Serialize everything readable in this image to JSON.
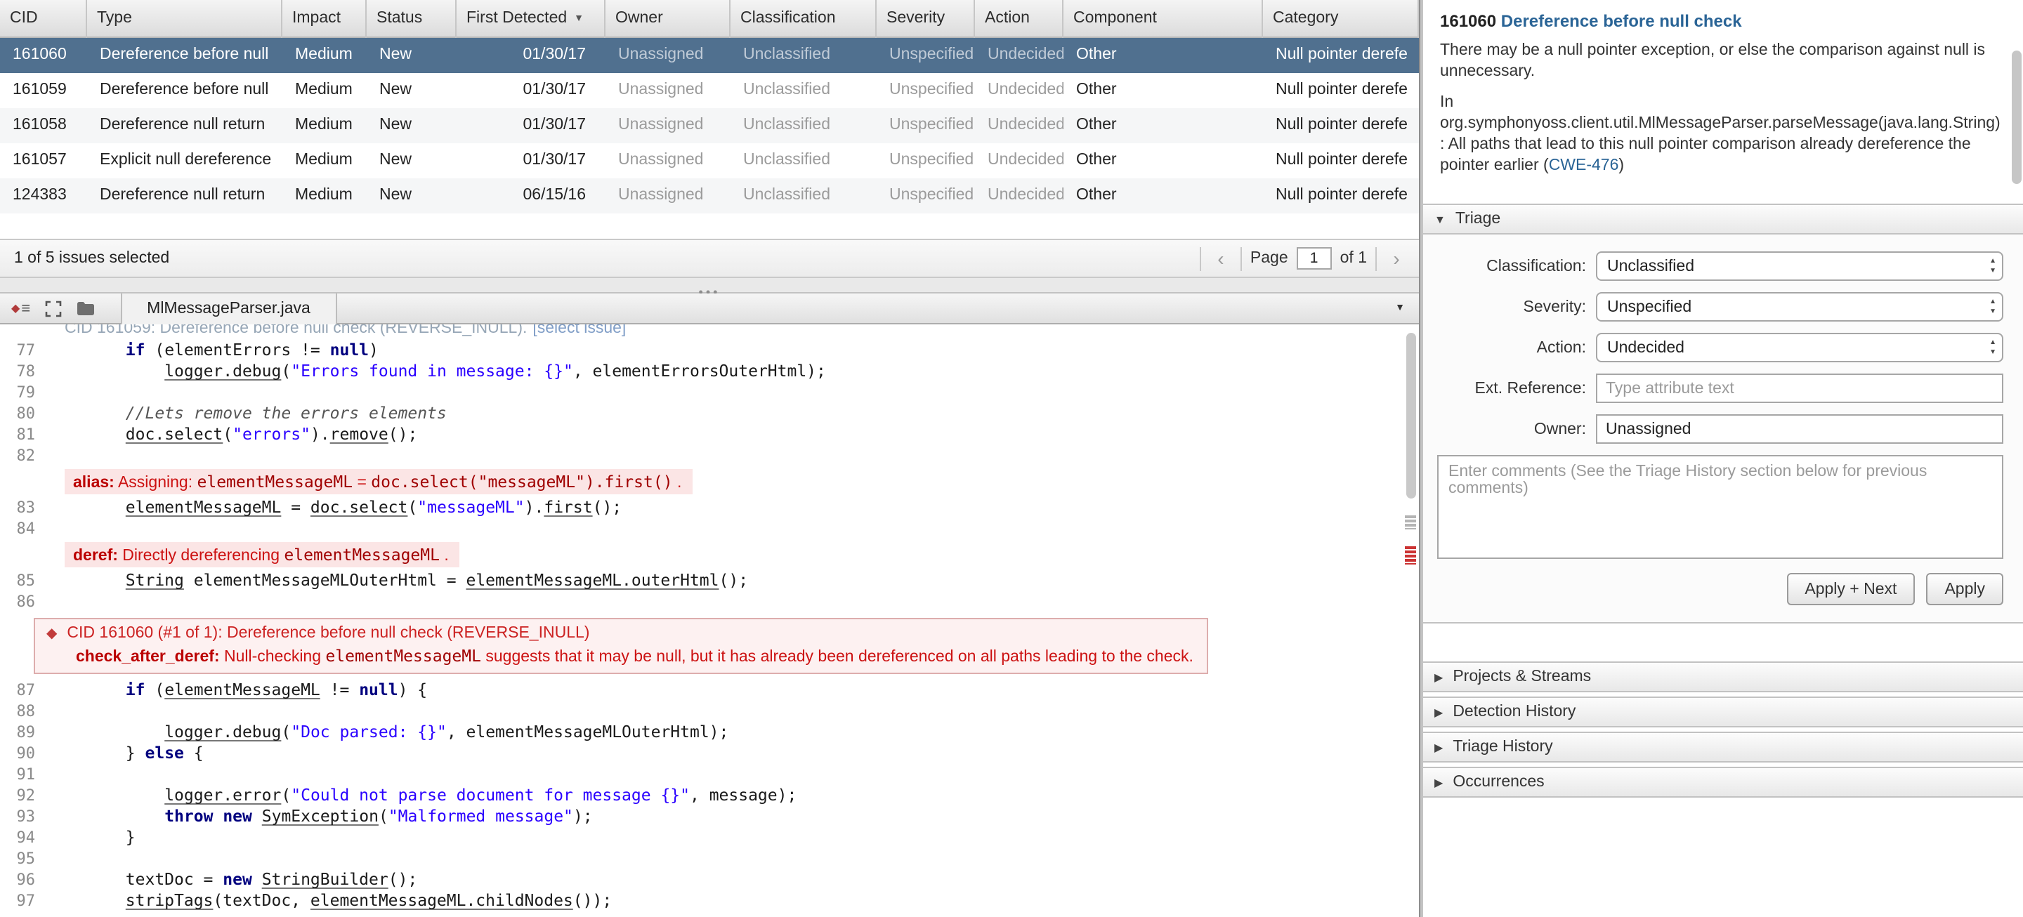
{
  "icons": {
    "sort_desc": "▼",
    "prev": "‹",
    "next": "›",
    "events_diamond": "◆",
    "events_lines": "≡",
    "dropdown": "▼",
    "grip": "•••",
    "expanded": "▼",
    "collapsed": "▶",
    "diamond": "◆",
    "stepper_up": "▲",
    "stepper_down": "▼"
  },
  "table": {
    "columns": [
      {
        "key": "cid",
        "label": "CID",
        "width": 62
      },
      {
        "key": "type",
        "label": "Type",
        "width": 139
      },
      {
        "key": "impact",
        "label": "Impact",
        "width": 60
      },
      {
        "key": "status",
        "label": "Status",
        "width": 64
      },
      {
        "key": "first_detected",
        "label": "First Detected",
        "width": 106,
        "sorted": true,
        "align": "right"
      },
      {
        "key": "owner",
        "label": "Owner",
        "width": 89,
        "muted": true
      },
      {
        "key": "classification",
        "label": "Classification",
        "width": 104,
        "muted": true
      },
      {
        "key": "severity",
        "label": "Severity",
        "width": 70,
        "muted": true
      },
      {
        "key": "action",
        "label": "Action",
        "width": 63,
        "muted": true
      },
      {
        "key": "component",
        "label": "Component",
        "width": 142
      },
      {
        "key": "category",
        "label": "Category",
        "width": 111
      }
    ],
    "rows": [
      {
        "cid": "161060",
        "type": "Dereference before null",
        "impact": "Medium",
        "status": "New",
        "first_detected": "01/30/17",
        "owner": "Unassigned",
        "classification": "Unclassified",
        "severity": "Unspecified",
        "action": "Undecided",
        "component": "Other",
        "category": "Null pointer derefe",
        "selected": true
      },
      {
        "cid": "161059",
        "type": "Dereference before null",
        "impact": "Medium",
        "status": "New",
        "first_detected": "01/30/17",
        "owner": "Unassigned",
        "classification": "Unclassified",
        "severity": "Unspecified",
        "action": "Undecided",
        "component": "Other",
        "category": "Null pointer derefe"
      },
      {
        "cid": "161058",
        "type": "Dereference null return",
        "impact": "Medium",
        "status": "New",
        "first_detected": "01/30/17",
        "owner": "Unassigned",
        "classification": "Unclassified",
        "severity": "Unspecified",
        "action": "Undecided",
        "component": "Other",
        "category": "Null pointer derefe"
      },
      {
        "cid": "161057",
        "type": "Explicit null dereference",
        "impact": "Medium",
        "status": "New",
        "first_detected": "01/30/17",
        "owner": "Unassigned",
        "classification": "Unclassified",
        "severity": "Unspecified",
        "action": "Undecided",
        "component": "Other",
        "category": "Null pointer derefe"
      },
      {
        "cid": "124383",
        "type": "Dereference null return",
        "impact": "Medium",
        "status": "New",
        "first_detected": "06/15/16",
        "owner": "Unassigned",
        "classification": "Unclassified",
        "severity": "Unspecified",
        "action": "Undecided",
        "component": "Other",
        "category": "Null pointer derefe"
      }
    ]
  },
  "footer": {
    "selection_text": "1 of 5 issues selected",
    "page_label": "Page",
    "page_value": "1",
    "page_total": "of 1"
  },
  "code": {
    "tab_title": "MlMessageParser.java",
    "clipped_text": "CID 161059: Dereference before null check (REVERSE_INULL).",
    "clipped_link": "[select issue]",
    "lines": [
      {
        "n": 77,
        "seg": [
          [
            "p",
            "        "
          ],
          [
            "kw",
            "if"
          ],
          [
            "p",
            " (elementErrors != "
          ],
          [
            "kw",
            "null"
          ],
          [
            "p",
            ")"
          ]
        ]
      },
      {
        "n": 78,
        "seg": [
          [
            "p",
            "            "
          ],
          [
            "m",
            "logger.debug"
          ],
          [
            "p",
            "("
          ],
          [
            "str",
            "\"Errors found in message: {}\""
          ],
          [
            "p",
            ", elementErrorsOuterHtml);"
          ]
        ]
      },
      {
        "n": 79,
        "seg": []
      },
      {
        "n": 80,
        "seg": [
          [
            "p",
            "        "
          ],
          [
            "com",
            "//Lets remove the errors elements"
          ]
        ]
      },
      {
        "n": 81,
        "seg": [
          [
            "p",
            "        "
          ],
          [
            "m",
            "doc.select"
          ],
          [
            "p",
            "("
          ],
          [
            "str",
            "\"errors\""
          ],
          [
            "p",
            ")."
          ],
          [
            "m",
            "remove"
          ],
          [
            "p",
            "();"
          ]
        ]
      },
      {
        "n": 82,
        "seg": []
      },
      {
        "type": "event",
        "label": "alias:",
        "parts": [
          [
            "t",
            " Assigning: "
          ],
          [
            "c",
            "elementMessageML"
          ],
          [
            "t",
            " = "
          ],
          [
            "c",
            "doc.select(\"messageML\").first()"
          ],
          [
            "t",
            " ."
          ]
        ]
      },
      {
        "n": 83,
        "seg": [
          [
            "p",
            "        "
          ],
          [
            "m",
            "elementMessageML"
          ],
          [
            "p",
            " = "
          ],
          [
            "m",
            "doc.select"
          ],
          [
            "p",
            "("
          ],
          [
            "str",
            "\"messageML\""
          ],
          [
            "p",
            ")."
          ],
          [
            "m",
            "first"
          ],
          [
            "p",
            "();"
          ]
        ]
      },
      {
        "n": 84,
        "seg": []
      },
      {
        "type": "event",
        "label": "deref:",
        "parts": [
          [
            "t",
            " Directly dereferencing "
          ],
          [
            "c",
            "elementMessageML"
          ],
          [
            "t",
            " ."
          ]
        ]
      },
      {
        "n": 85,
        "seg": [
          [
            "p",
            "        "
          ],
          [
            "m",
            "String"
          ],
          [
            "p",
            " elementMessageMLOuterHtml = "
          ],
          [
            "m",
            "elementMessageML.outerHtml"
          ],
          [
            "p",
            "();"
          ]
        ]
      },
      {
        "n": 86,
        "seg": []
      },
      {
        "type": "eventbox",
        "line1": "CID 161060 (#1 of 1): Dereference before null check (REVERSE_INULL)",
        "label2": "check_after_deref:",
        "parts2": [
          [
            "t",
            " Null-checking "
          ],
          [
            "c",
            "elementMessageML"
          ],
          [
            "t",
            " suggests that it may be null, but it has already been dereferenced on all paths leading to the check."
          ]
        ]
      },
      {
        "n": 87,
        "seg": [
          [
            "p",
            "        "
          ],
          [
            "kw",
            "if"
          ],
          [
            "p",
            " ("
          ],
          [
            "m",
            "elementMessageML"
          ],
          [
            "p",
            " != "
          ],
          [
            "kw",
            "null"
          ],
          [
            "p",
            ") {"
          ]
        ]
      },
      {
        "n": 88,
        "seg": []
      },
      {
        "n": 89,
        "seg": [
          [
            "p",
            "            "
          ],
          [
            "m",
            "logger.debug"
          ],
          [
            "p",
            "("
          ],
          [
            "str",
            "\"Doc parsed: {}\""
          ],
          [
            "p",
            ", elementMessageMLOuterHtml);"
          ]
        ]
      },
      {
        "n": 90,
        "seg": [
          [
            "p",
            "        } "
          ],
          [
            "kw",
            "else"
          ],
          [
            "p",
            " {"
          ]
        ]
      },
      {
        "n": 91,
        "seg": []
      },
      {
        "n": 92,
        "seg": [
          [
            "p",
            "            "
          ],
          [
            "m",
            "logger.error"
          ],
          [
            "p",
            "("
          ],
          [
            "str",
            "\"Could not parse document for message {}\""
          ],
          [
            "p",
            ", message);"
          ]
        ]
      },
      {
        "n": 93,
        "seg": [
          [
            "p",
            "            "
          ],
          [
            "kw",
            "throw"
          ],
          [
            "p",
            " "
          ],
          [
            "kw",
            "new"
          ],
          [
            "p",
            " "
          ],
          [
            "m",
            "SymException"
          ],
          [
            "p",
            "("
          ],
          [
            "str",
            "\"Malformed message\""
          ],
          [
            "p",
            ");"
          ]
        ]
      },
      {
        "n": 94,
        "seg": [
          [
            "p",
            "        }"
          ]
        ]
      },
      {
        "n": 95,
        "seg": []
      },
      {
        "n": 96,
        "seg": [
          [
            "p",
            "        textDoc = "
          ],
          [
            "kw",
            "new"
          ],
          [
            "p",
            " "
          ],
          [
            "m",
            "StringBuilder"
          ],
          [
            "p",
            "();"
          ]
        ]
      },
      {
        "n": 97,
        "seg": [
          [
            "p",
            "        "
          ],
          [
            "m",
            "stripTags"
          ],
          [
            "p",
            "(textDoc, "
          ],
          [
            "m",
            "elementMessageML.childNodes"
          ],
          [
            "p",
            "());"
          ]
        ]
      }
    ]
  },
  "details": {
    "cid": "161060",
    "title": "Dereference before null check",
    "summary": "There may be a null pointer exception, or else the comparison against null is unnecessary.",
    "description_pre": "In org.symphonyoss.client.util.MlMessageParser.parseMessage(java.lang.String): All paths that lead to this null pointer comparison already dereference the pointer earlier (",
    "cwe_link": "CWE-476",
    "description_post": ")",
    "triage": {
      "header": "Triage",
      "fields": [
        {
          "name": "classification",
          "label": "Classification:",
          "type": "select",
          "value": "Unclassified"
        },
        {
          "name": "severity",
          "label": "Severity:",
          "type": "select",
          "value": "Unspecified"
        },
        {
          "name": "action",
          "label": "Action:",
          "type": "select",
          "value": "Undecided"
        },
        {
          "name": "ext-reference",
          "label": "Ext. Reference:",
          "type": "text",
          "placeholder": "Type attribute text",
          "value": ""
        },
        {
          "name": "owner",
          "label": "Owner:",
          "type": "text",
          "value": "Unassigned"
        }
      ],
      "comment_placeholder": "Enter comments (See the Triage History section below for previous comments)",
      "buttons": [
        "Apply + Next",
        "Apply"
      ]
    },
    "sections": [
      "Projects & Streams",
      "Detection History",
      "Triage History",
      "Occurrences"
    ]
  }
}
